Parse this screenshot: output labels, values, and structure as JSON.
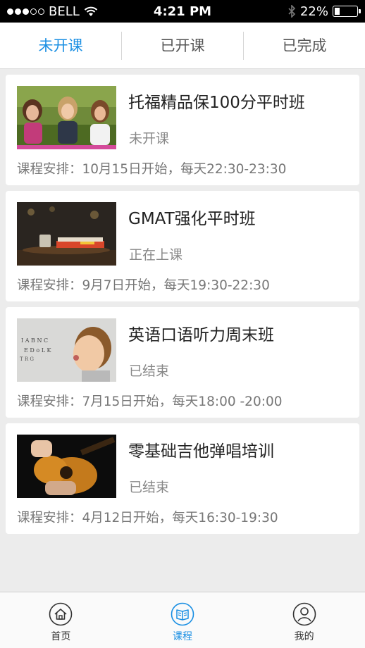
{
  "status_bar": {
    "carrier": "BELL",
    "time": "4:21 PM",
    "battery": "22%",
    "battery_level": 0.22
  },
  "tabs": [
    {
      "label": "未开课",
      "active": true
    },
    {
      "label": "已开课",
      "active": false
    },
    {
      "label": "已完成",
      "active": false
    }
  ],
  "courses": [
    {
      "title": "托福精品保100分平时班",
      "status": "未开课",
      "schedule": "课程安排：10月15日开始，每天22:30-23:30",
      "image": "three-girls-photo"
    },
    {
      "title": "GMAT强化平时班",
      "status": "正在上课",
      "schedule": "课程安排：9月7日开始，每天19:30-22:30",
      "image": "books-cafe-photo"
    },
    {
      "title": "英语口语听力周末班",
      "status": "已结束",
      "schedule": "课程安排：7月15日开始，每天18:00 -20:00",
      "image": "boy-speaking-photo"
    },
    {
      "title": "零基础吉他弹唱培训",
      "status": "已结束",
      "schedule": "课程安排：4月12日开始，每天16:30-19:30",
      "image": "guitar-photo"
    }
  ],
  "bottom_nav": [
    {
      "label": "首页",
      "icon": "home-icon",
      "active": false
    },
    {
      "label": "课程",
      "icon": "book-icon",
      "active": true
    },
    {
      "label": "我的",
      "icon": "user-icon",
      "active": false
    }
  ],
  "colors": {
    "accent": "#1a8fe3",
    "background": "#ececec"
  }
}
